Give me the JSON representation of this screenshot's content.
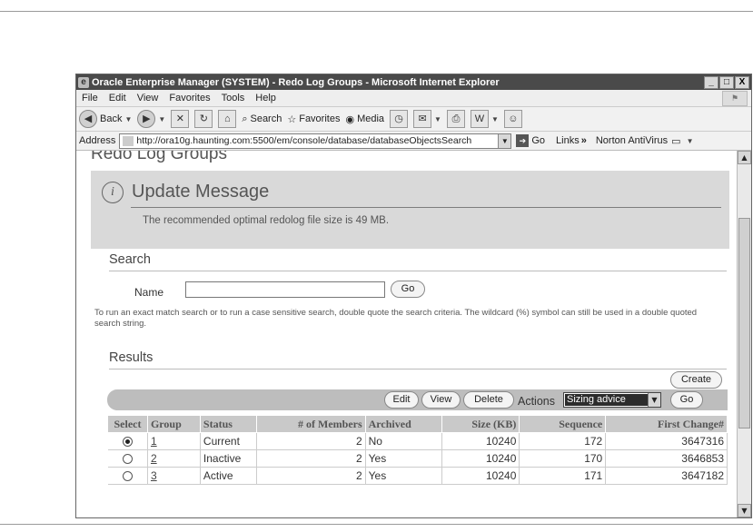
{
  "window": {
    "title": "Oracle Enterprise Manager (SYSTEM) - Redo Log Groups - Microsoft Internet Explorer",
    "buttons": [
      "_",
      "□",
      "X"
    ]
  },
  "menubar": [
    "File",
    "Edit",
    "View",
    "Favorites",
    "Tools",
    "Help"
  ],
  "toolbar": {
    "back": "Back",
    "search": "Search",
    "favorites": "Favorites",
    "media": "Media"
  },
  "address": {
    "label": "Address",
    "url": "http://ora10g.haunting.com:5500/em/console/database/databaseObjectsSearch",
    "go": "Go",
    "links": "Links",
    "links_chevron": "»",
    "norton": "Norton AntiVirus"
  },
  "page": {
    "title": "Redo Log Groups",
    "update_title": "Update Message",
    "update_text": "The recommended optimal redolog file size is 49 MB.",
    "info_glyph": "i"
  },
  "search": {
    "heading": "Search",
    "name_label": "Name",
    "name_value": "",
    "go": "Go",
    "help": "To run an exact match search or to run a case sensitive search, double quote the search criteria. The wildcard (%) symbol can still be used in a double quoted search string."
  },
  "results": {
    "heading": "Results",
    "create": "Create",
    "edit": "Edit",
    "view": "View",
    "delete": "Delete",
    "actions_label": "Actions",
    "actions_selected": "Sizing advice",
    "go": "Go",
    "columns": [
      "Select",
      "Group",
      "Status",
      "# of Members",
      "Archived",
      "Size (KB)",
      "Sequence",
      "First Change#"
    ],
    "rows": [
      {
        "selected": true,
        "group": "1",
        "status": "Current",
        "members": "2",
        "archived": "No",
        "size": "10240",
        "sequence": "172",
        "first_change": "3647316"
      },
      {
        "selected": false,
        "group": "2",
        "status": "Inactive",
        "members": "2",
        "archived": "Yes",
        "size": "10240",
        "sequence": "170",
        "first_change": "3646853"
      },
      {
        "selected": false,
        "group": "3",
        "status": "Active",
        "members": "2",
        "archived": "Yes",
        "size": "10240",
        "sequence": "171",
        "first_change": "3647182"
      }
    ]
  }
}
